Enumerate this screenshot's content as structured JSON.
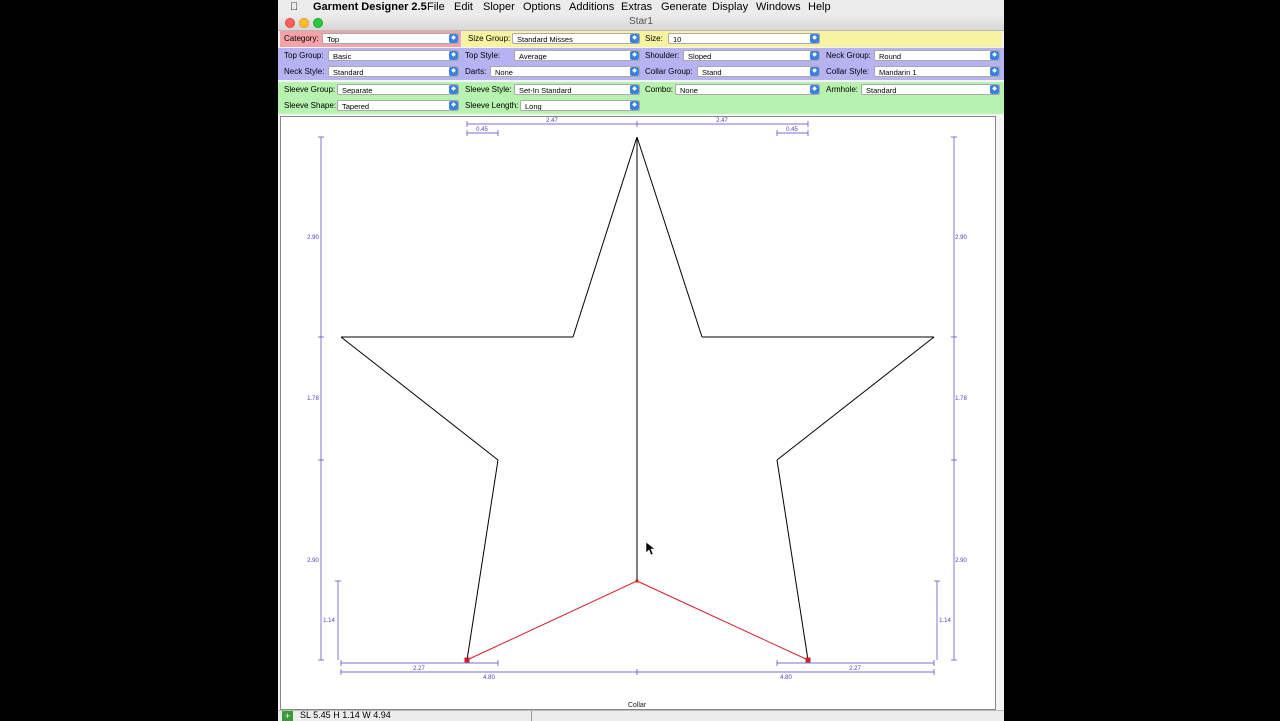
{
  "menubar": {
    "app_name": "Garment Designer 2.5",
    "items": [
      "File",
      "Edit",
      "Sloper",
      "Options",
      "Additions",
      "Extras",
      "Generate",
      "Display",
      "Windows",
      "Help"
    ]
  },
  "window": {
    "title": "Star1"
  },
  "header": {
    "category": {
      "label": "Category:",
      "value": "Top"
    },
    "size_group": {
      "label": "Size Group:",
      "value": "Standard Misses"
    },
    "size": {
      "label": "Size:",
      "value": "10"
    }
  },
  "top_options": {
    "top_group": {
      "label": "Top Group:",
      "value": "Basic"
    },
    "top_style": {
      "label": "Top Style:",
      "value": "Average"
    },
    "shoulder": {
      "label": "Shoulder:",
      "value": "Sloped"
    },
    "neck_group": {
      "label": "Neck Group:",
      "value": "Round"
    },
    "neck_style": {
      "label": "Neck Style:",
      "value": "Standard"
    },
    "darts": {
      "label": "Darts:",
      "value": "None"
    },
    "collar_group": {
      "label": "Collar Group:",
      "value": "Stand"
    },
    "collar_style": {
      "label": "Collar Style:",
      "value": "Mandarin 1"
    }
  },
  "sleeve_options": {
    "sleeve_group": {
      "label": "Sleeve Group:",
      "value": "Separate"
    },
    "sleeve_style": {
      "label": "Sleeve Style:",
      "value": "Set-In Standard"
    },
    "combo": {
      "label": "Combo:",
      "value": "None"
    },
    "armhole": {
      "label": "Armhole:",
      "value": "Standard"
    },
    "sleeve_shape": {
      "label": "Sleeve Shape:",
      "value": "Tapered"
    },
    "sleeve_length": {
      "label": "Sleeve Length:",
      "value": "Long"
    }
  },
  "drawing": {
    "dimensions": {
      "top_half_width": "2.47",
      "top_notch": "0.45",
      "side_upper": "2.90",
      "side_middle": "1.78",
      "side_lower": "2.90",
      "bottom_rise": "1.14",
      "bottom_inner": "2.27",
      "bottom_outer": "4.80"
    },
    "piece_label": "Collar",
    "colors": {
      "outline": "#000000",
      "seam": "#d0202a",
      "dimension": "#4a3fc4"
    }
  },
  "status": {
    "text": "SL 5.45  H 1.14  W 4.94"
  },
  "colors": {
    "category_band": "#f5a3a8",
    "size_group_band": "#f7f3a0",
    "top_band": "#b7b3f2",
    "sleeve_band": "#b7f2b0"
  }
}
